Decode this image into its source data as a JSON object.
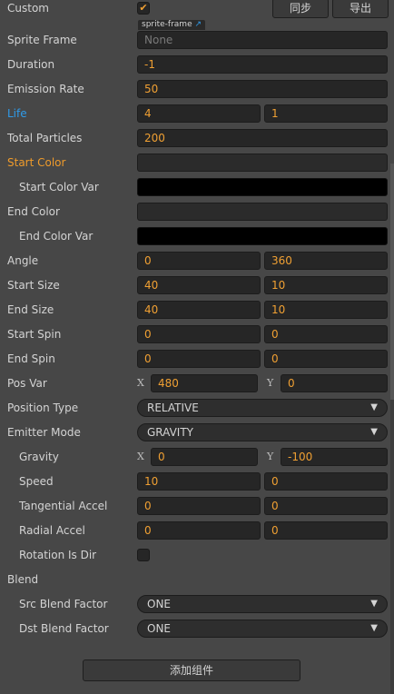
{
  "custom": {
    "label": "Custom",
    "checked": true,
    "check_glyph": "✔"
  },
  "buttons": {
    "sync": "同步",
    "export": "导出",
    "add_component": "添加组件"
  },
  "sprite_frame": {
    "label": "Sprite Frame",
    "value": "None",
    "tag": "sprite-frame",
    "tag_icon": "↗"
  },
  "duration": {
    "label": "Duration",
    "value": "-1"
  },
  "emission_rate": {
    "label": "Emission Rate",
    "value": "50"
  },
  "life": {
    "label": "Life",
    "value": "4",
    "var": "1"
  },
  "total_particles": {
    "label": "Total Particles",
    "value": "200"
  },
  "start_color": {
    "label": "Start Color",
    "color": "#2b2b2b"
  },
  "start_color_var": {
    "label": "Start Color Var",
    "color": "#000000"
  },
  "end_color": {
    "label": "End Color",
    "color": "#2b2b2b"
  },
  "end_color_var": {
    "label": "End Color Var",
    "color": "#000000"
  },
  "angle": {
    "label": "Angle",
    "value": "0",
    "var": "360"
  },
  "start_size": {
    "label": "Start Size",
    "value": "40",
    "var": "10"
  },
  "end_size": {
    "label": "End Size",
    "value": "40",
    "var": "10"
  },
  "start_spin": {
    "label": "Start Spin",
    "value": "0",
    "var": "0"
  },
  "end_spin": {
    "label": "End Spin",
    "value": "0",
    "var": "0"
  },
  "pos_var": {
    "label": "Pos Var",
    "x_axis": "X",
    "x": "480",
    "y_axis": "Y",
    "y": "0"
  },
  "position_type": {
    "label": "Position Type",
    "value": "RELATIVE",
    "arrow": "▼"
  },
  "emitter_mode": {
    "label": "Emitter Mode",
    "value": "GRAVITY",
    "arrow": "▼"
  },
  "gravity": {
    "label": "Gravity",
    "x_axis": "X",
    "x": "0",
    "y_axis": "Y",
    "y": "-100"
  },
  "speed": {
    "label": "Speed",
    "value": "10",
    "var": "0"
  },
  "tangential_accel": {
    "label": "Tangential Accel",
    "value": "0",
    "var": "0"
  },
  "radial_accel": {
    "label": "Radial Accel",
    "value": "0",
    "var": "0"
  },
  "rotation_is_dir": {
    "label": "Rotation Is Dir",
    "checked": false
  },
  "blend": {
    "label": "Blend"
  },
  "src_blend_factor": {
    "label": "Src Blend Factor",
    "value": "ONE",
    "arrow": "▼"
  },
  "dst_blend_factor": {
    "label": "Dst Blend Factor",
    "value": "ONE",
    "arrow": "▼"
  },
  "colors": {
    "background": "#474747",
    "field": "#262626",
    "value_text": "#f0a033",
    "life_label": "#2f9bea",
    "start_color_label": "#ef9b2b"
  }
}
